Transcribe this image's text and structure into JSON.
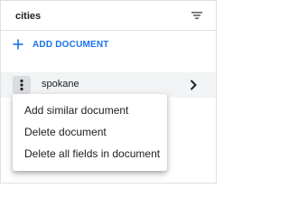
{
  "panel": {
    "collection_title": "cities",
    "filter_icon": "filter-list-icon",
    "add_document_icon": "plus-icon",
    "add_document_label": "ADD DOCUMENT",
    "accent_color": "#1a73e8"
  },
  "documents": [
    {
      "name": "spokane",
      "selected": true
    }
  ],
  "row_icons": {
    "menu": "more-vert-icon",
    "open": "chevron-right-icon"
  },
  "context_menu": {
    "items": [
      {
        "label": "Add similar document"
      },
      {
        "label": "Delete document"
      },
      {
        "label": "Delete all fields in document"
      }
    ]
  }
}
